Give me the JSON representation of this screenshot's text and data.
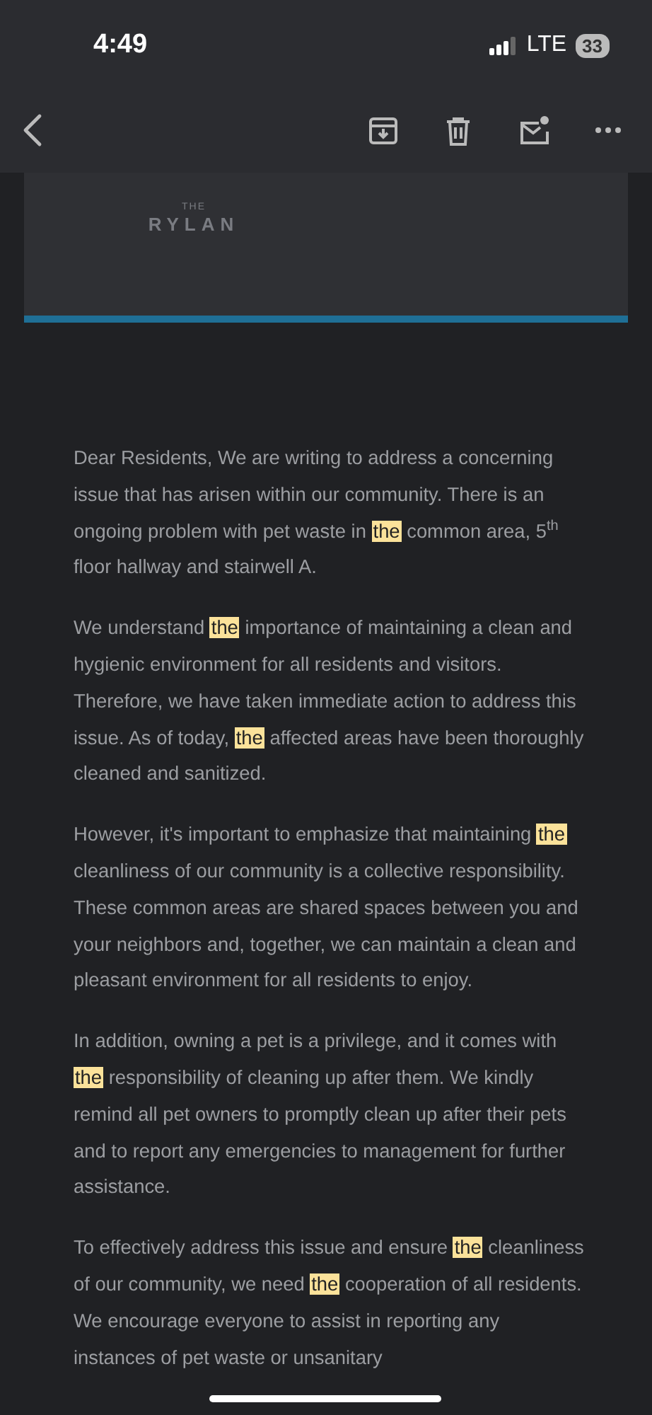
{
  "status_bar": {
    "time": "4:49",
    "network": "LTE",
    "battery": "33"
  },
  "toolbar": {
    "actions": [
      {
        "kind": "archive"
      },
      {
        "kind": "delete"
      },
      {
        "kind": "mark-unread"
      },
      {
        "kind": "more"
      }
    ]
  },
  "email": {
    "logo": {
      "small": "THE",
      "name": "RYLAN"
    },
    "paragraphs": [
      [
        {
          "text": "Dear Residents, We are writing to address a concerning issue that has arisen within our community. There is an ongoing problem with pet waste in ",
          "highlighted": false
        },
        {
          "text": "the",
          "highlighted": true
        },
        {
          "text": " common area, 5$^{th}$ floor hallway and stairwell A.",
          "highlighted": false
        }
      ],
      [
        {
          "text": "We understand ",
          "highlighted": false
        },
        {
          "text": "the",
          "highlighted": true
        },
        {
          "text": " importance of maintaining a clean and hygienic environment for all residents and visitors. Therefore, we have taken immediate action to address this issue. As of today, ",
          "highlighted": false
        },
        {
          "text": "the",
          "highlighted": true
        },
        {
          "text": " affected areas have been thoroughly cleaned and sanitized.",
          "highlighted": false
        }
      ],
      [
        {
          "text": "However, it's important to emphasize that maintaining ",
          "highlighted": false
        },
        {
          "text": "the",
          "highlighted": true
        },
        {
          "text": " cleanliness of our community is a collective responsibility. These common areas are shared spaces between you and your neighbors and, together, we can maintain a clean and pleasant environment for all residents to enjoy.",
          "highlighted": false
        }
      ],
      [
        {
          "text": "In addition, owning a pet is a privilege, and it comes with ",
          "highlighted": false
        },
        {
          "text": "the",
          "highlighted": true
        },
        {
          "text": " responsibility of cleaning up after them. We kindly remind all pet owners to promptly clean up after their pets and to report any emergencies to management for further assistance.",
          "highlighted": false
        }
      ],
      [
        {
          "text": "To effectively address this issue and ensure ",
          "highlighted": false
        },
        {
          "text": "the",
          "highlighted": true
        },
        {
          "text": " cleanliness of our community, we need ",
          "highlighted": false
        },
        {
          "text": "the",
          "highlighted": true
        },
        {
          "text": " cooperation of all residents. We encourage everyone to assist in reporting any instances of pet waste or unsanitary",
          "highlighted": false
        }
      ]
    ]
  }
}
